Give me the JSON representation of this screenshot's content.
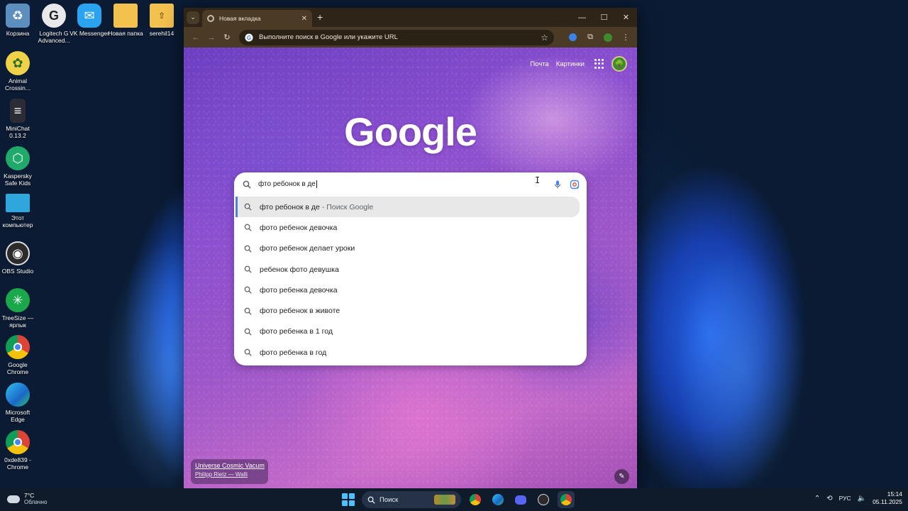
{
  "desktop": {
    "icons": [
      {
        "label": "Корзина",
        "icon": "recycle-bin-icon",
        "color": "#6aa7d8"
      },
      {
        "label": "Logitech G Advanced...",
        "icon": "logitech-g-icon",
        "color": "#e8e8e8"
      },
      {
        "label": "VK Messenger",
        "icon": "vk-messenger-icon",
        "color": "#2aa3f0"
      },
      {
        "label": "Новая папка",
        "icon": "folder-icon",
        "color": "#f2c14e"
      },
      {
        "label": "serehil14",
        "icon": "folder-zip-icon",
        "color": "#f2c14e"
      },
      {
        "label": "Animal Crossin...",
        "icon": "animal-crossing-icon",
        "color": "#f0d24a"
      },
      {
        "label": "MiniChat 0.13.2",
        "icon": "minichat-icon",
        "color": "#2c2c34"
      },
      {
        "label": "Kaspersky Safe Kids",
        "icon": "kaspersky-icon",
        "color": "#1fa96a"
      },
      {
        "label": "Этот компьютер",
        "icon": "computer-icon",
        "color": "#2fa7dc"
      },
      {
        "label": "OBS Studio",
        "icon": "obs-icon",
        "color": "#2b2b2b"
      },
      {
        "label": "TreeSize — ярлык",
        "icon": "treesize-icon",
        "color": "#1aa84b"
      },
      {
        "label": "Google Chrome",
        "icon": "chrome-icon",
        "color": "#dd4b39"
      },
      {
        "label": "Microsoft Edge",
        "icon": "edge-icon",
        "color": "#1d8fcf"
      },
      {
        "label": "0xde839 - Chrome",
        "icon": "chrome-profile-icon",
        "color": "#dd4b39"
      }
    ]
  },
  "browser": {
    "tab_title": "Новая вкладка",
    "omnibox_placeholder": "Выполните поиск в Google или укажите URL",
    "top_links": {
      "mail": "Почта",
      "images": "Картинки"
    },
    "logo": "Google",
    "search": {
      "query": "фто ребонок в де",
      "suggestions": [
        {
          "text": "фто ребонок в де",
          "suffix": "- Поиск Google",
          "highlighted": true
        },
        {
          "text": "фото ребенок девочка",
          "suffix": "",
          "highlighted": false
        },
        {
          "text": "фото ребенок делает уроки",
          "suffix": "",
          "highlighted": false
        },
        {
          "text": "ребенок фото девушка",
          "suffix": "",
          "highlighted": false
        },
        {
          "text": "фото ребенка девочка",
          "suffix": "",
          "highlighted": false
        },
        {
          "text": "фото ребенок в животе",
          "suffix": "",
          "highlighted": false
        },
        {
          "text": "фото ребенка в 1 год",
          "suffix": "",
          "highlighted": false
        },
        {
          "text": "фото ребенка в год",
          "suffix": "",
          "highlighted": false
        }
      ]
    },
    "credit": {
      "title": "Universe Cosmic Vacum",
      "author": "Philipp Rietz — Walli"
    }
  },
  "taskbar": {
    "weather_temp": "7°C",
    "weather_desc": "Облачно",
    "search_label": "Поиск",
    "language": "РУС",
    "time": "15:14",
    "date": "05.11.2025"
  },
  "colors": {
    "accent": "#4f7fd8",
    "windows_blue": "#4cc2ff"
  }
}
